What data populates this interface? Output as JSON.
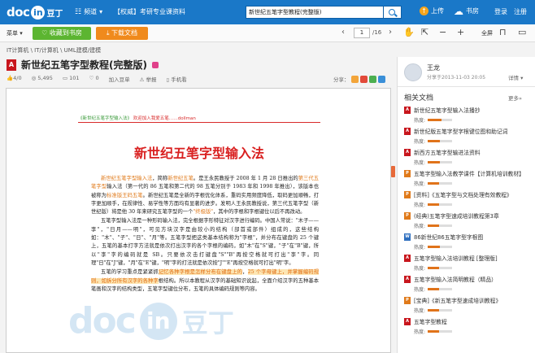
{
  "topbar": {
    "logo_doc": "doc",
    "logo_in": "in",
    "logo_cn": "豆丁",
    "channel_label": "频道",
    "promo": "【权威】考研专业课资料",
    "search_value": "新世纪五笔字型教程(完整版)",
    "upload_label": "上传",
    "shelf_label": "书房",
    "login_label": "登录",
    "register_label": "注册"
  },
  "toolbar": {
    "menu_label": "菜单",
    "favorite_label": "收藏到书房",
    "download_label": "下载文档",
    "page_current": "1",
    "page_total": "/16",
    "fullscreen_label": "全屏"
  },
  "doc": {
    "breadcrumb": "IT计算机 \\ IT/计算机 \\ UML建模/建模",
    "title": "新世纪五笔字型教程(完整版)",
    "likes": "4",
    "dislikes": "0",
    "views": "5,495",
    "comments": "101",
    "favorites": "0",
    "add_shelf": "加入豆单",
    "report": "举报",
    "phone_read": "手机看",
    "share_label": "分享："
  },
  "page": {
    "header_left": "《新世纪五笔字型输入法》",
    "header_right": "欢迎加入我爱五笔……dollman",
    "big_title": "新世纪五笔字型输入法",
    "p1_a": "新世纪五笔字型输入法",
    "p1_b": "，简称",
    "p1_c": "新世纪五笔",
    "p1_d": "。是王永民教授于 2008 年 1 月 28 日推出的",
    "p1_e": "第三代五笔字型",
    "p1_f": "输入法（第一代的 86 五笔和第二代的 98 五笔分别于 1983 年和 1998 年推出），该版本也被称为",
    "p1_g": "标准版王码五笔",
    "p1_h": "。新世纪五笔是全新的字根优化体系，重码实用频度降低，取码更加顺畅，打字更加顺手，在规律性、易学性等方面均有显著的进步。发明人王永民教授说，第三代五笔字型（新世纪版）将是他 30 年来研究五笔字型的一个",
    "p1_i": "\"终极版\"",
    "p1_j": "，其中的字根和字根键位以后不再改动。",
    "p2": "五笔字型输入法是一种形码输入法，完全根据字形特征对汉字进行编码。中国人常说：\"木子——李\"，\"日月——明\"，可见方块汉字是由较小的结构（部首或部件）组成的，这些结构如：\"木\"、\"子\"、\"日\"、\"月\"等。五笔字型把这类基本结构称为\"字根\"，并分布在键盘的 25 个键上，五笔的基本打字方法就是依次打出汉字的各个字根的编码，如\"木\"在\"S\"键，\"子\"在\"B\"键，所以\"李\"字的编码就是 SB。只要依次击打键盘\"S\"\"B\"再按空格就可打出\"李\"字。同理\"日\"在\"J\"键，\"月\"在\"E\"键，\"明\"字的打法就是依次按\"J\"\"E\"再按空格就可打出\"明\"字。",
    "p3_a": "五笔的学习重点是紧紧抓",
    "p3_b": "记忆各种字根是怎样分布在键盘上的",
    "p3_c": "，",
    "p3_d": "",
    "p3_e": "25 个字母键上，并掌握编码规则，如拆分所有",
    "p3_f": "汉字的各种字",
    "p3_g": "根结构。所以本教程从汉字的基础知识说起，全面介绍汉字的五种基本笔画和汉字的结构类型，五笔字型键位分布，五笔的具体编码规则等内容。"
  },
  "sidebar": {
    "user_name": "王龙",
    "user_time": "分享于2013-11-03 20:05",
    "detail_label": "详情",
    "related_title": "相关文档",
    "more_label": "更多»",
    "heat_label": "热度:",
    "items": [
      {
        "name": "新世纪五笔字型输入法播抄",
        "icon": "pdf",
        "heat": 0.55
      },
      {
        "name": "新世纪版五笔字型字根键位图和助记词",
        "icon": "pdf",
        "heat": 0.5
      },
      {
        "name": "新西方五笔字型输进法资料",
        "icon": "pdf",
        "heat": 0.5
      },
      {
        "name": "五笔字型输入法教学课件【计算机培训教材】",
        "icon": "ppt",
        "heat": 0.45
      },
      {
        "name": "[资料]《五笔字型与文档处理有效教程》",
        "icon": "ppt",
        "heat": 0.45
      },
      {
        "name": "(经典)五笔字型速成培训教程第3章",
        "icon": "ppt",
        "heat": 0.45
      },
      {
        "name": "86新世纪86五笔字型字根图",
        "icon": "doc",
        "heat": 0.5
      },
      {
        "name": "五笔字型输入法培训教程 [整理版]",
        "icon": "pdf",
        "heat": 0.45
      },
      {
        "name": "五笔字型输入法简明教程（精品）",
        "icon": "pdf",
        "heat": 0.45
      },
      {
        "name": "[宝典]《新五笔字型速成培训教程》",
        "icon": "ppt",
        "heat": 0.45
      },
      {
        "name": "五笔字型教程",
        "icon": "pdf",
        "heat": 0.45
      }
    ]
  }
}
